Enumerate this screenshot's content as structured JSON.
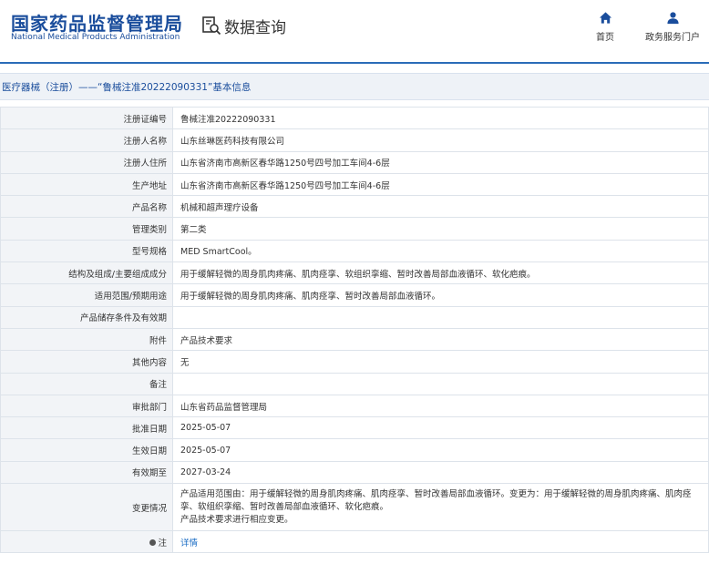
{
  "header": {
    "logo_cn": "国家药品监督管理局",
    "logo_en": "National Medical Products Administration",
    "subtitle": "数据查询",
    "nav": [
      {
        "label": "首页",
        "icon": "home-icon"
      },
      {
        "label": "政务服务门户",
        "icon": "user-icon"
      }
    ]
  },
  "title": "医疗器械（注册）——“鲁械注准20222090331”基本信息",
  "colors": {
    "brand": "#1a4d9c",
    "link": "#1a6cc4",
    "label_bg": "#f2f4f7"
  },
  "rows": [
    {
      "label": "注册证编号",
      "value": "鲁械注准20222090331"
    },
    {
      "label": "注册人名称",
      "value": "山东丝琳医药科技有限公司"
    },
    {
      "label": "注册人住所",
      "value": "山东省济南市高新区春华路1250号四号加工车间4-6层"
    },
    {
      "label": "生产地址",
      "value": "山东省济南市高新区春华路1250号四号加工车间4-6层"
    },
    {
      "label": "产品名称",
      "value": "机械和超声理疗设备"
    },
    {
      "label": "管理类别",
      "value": "第二类"
    },
    {
      "label": "型号规格",
      "value": "MED SmartCool。"
    },
    {
      "label": "结构及组成/主要组成成分",
      "value": "用于缓解轻微的周身肌肉疼痛、肌肉痉挛、软组织挛缩、暂时改善局部血液循环、软化疤痕。"
    },
    {
      "label": "适用范围/预期用途",
      "value": "用于缓解轻微的周身肌肉疼痛、肌肉痉挛、暂时改善局部血液循环。"
    },
    {
      "label": "产品储存条件及有效期",
      "value": ""
    },
    {
      "label": "附件",
      "value": "产品技术要求"
    },
    {
      "label": "其他内容",
      "value": "无"
    },
    {
      "label": "备注",
      "value": ""
    },
    {
      "label": "审批部门",
      "value": "山东省药品监督管理局"
    },
    {
      "label": "批准日期",
      "value": "2025-05-07"
    },
    {
      "label": "生效日期",
      "value": "2025-05-07"
    },
    {
      "label": "有效期至",
      "value": "2027-03-24"
    }
  ],
  "change": {
    "label": "变更情况",
    "line1": "产品适用范围由：用于缓解轻微的周身肌肉疼痛、肌肉痉挛、暂时改善局部血液循环。变更为：用于缓解轻微的周身肌肉疼痛、肌肉痉挛、软组织挛缩、暂时改善局部血液循环、软化疤痕。",
    "line2": "产品技术要求进行相应变更。"
  },
  "note": {
    "label": "注",
    "link": "详情"
  }
}
